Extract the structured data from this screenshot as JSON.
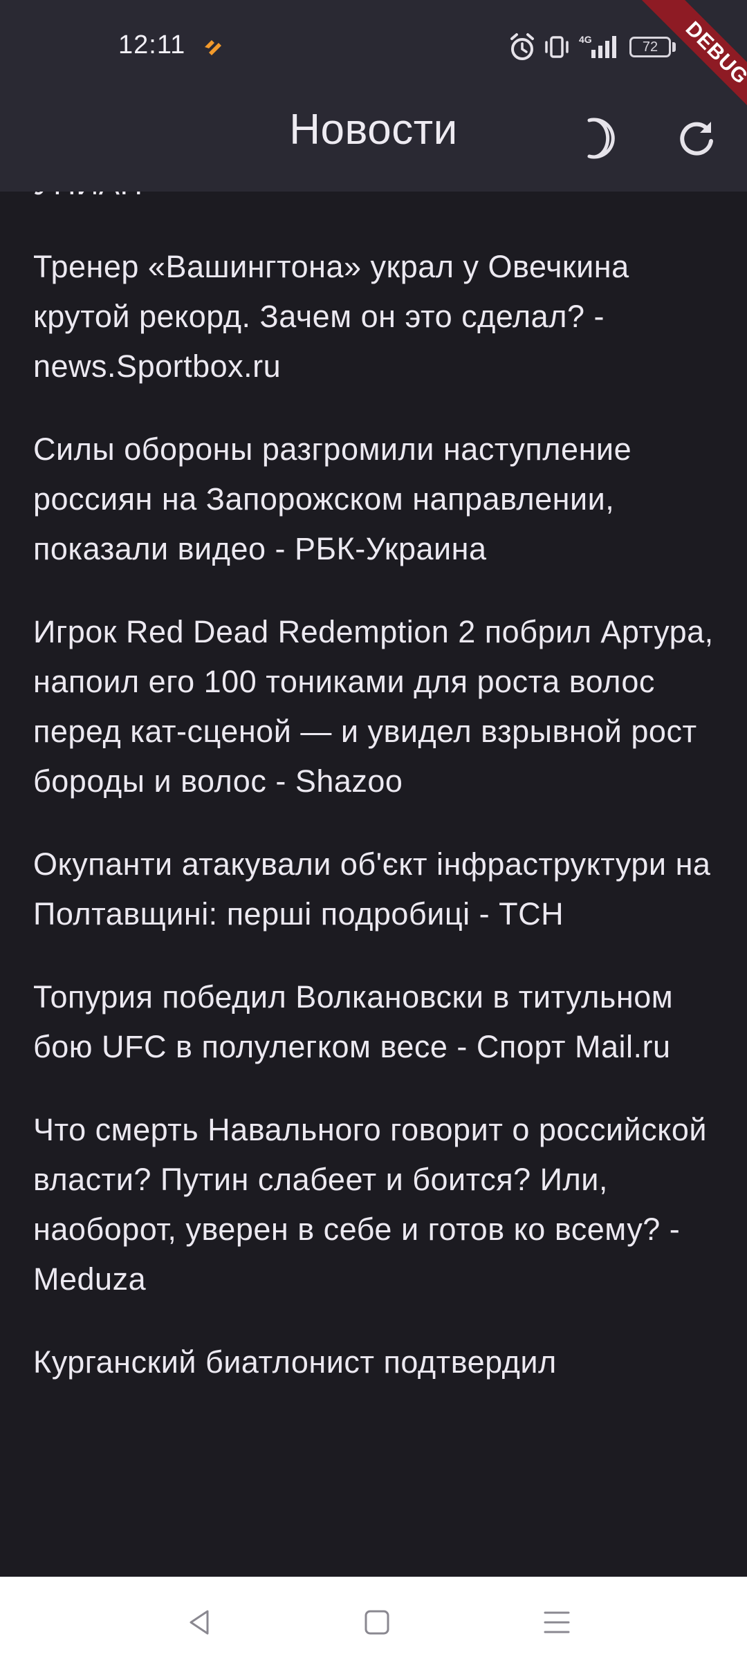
{
  "status_bar": {
    "time": "12:11",
    "network_label": "4G",
    "battery_level": "72"
  },
  "app_bar": {
    "title": "Новости",
    "icons": [
      "moon-icon",
      "refresh-icon"
    ]
  },
  "debug_banner": "DEBUG",
  "news": [
    "УНИАН",
    "Тренер «Вашингтона» украл у Овечкина крутой рекорд. Зачем он это сделал? - news.Sportbox.ru",
    "Силы обороны разгромили наступление россиян на Запорожском направлении, показали видео - РБК-Украина",
    "Игрок Red Dead Redemption 2 побрил Артура, напоил его 100 тониками для роста волос перед кат-сценой — и увидел взрывной рост бороды и волос - Shazoo",
    "Окупанти атакували об'єкт інфраструктури на Полтавщині: перші подробиці - ТСН",
    "Топурия победил Волкановски в титульном бою UFC в полулегком весе - Спорт Mail.ru",
    "Что смерть Навального говорит о российской власти? Путин слабеет и боится? Или, наоборот, уверен в себе и готов ко всему? - Meduza",
    "Курганский биатлонист подтвердил"
  ],
  "nav_bar": {
    "icons": [
      "back-icon",
      "home-icon",
      "menu-icon"
    ]
  },
  "colors": {
    "background": "#1c1b21",
    "app_bar": "#2a2933",
    "text": "#ece9f1",
    "debug_ribbon": "#8e1b24",
    "nav_bar": "#ffffff"
  }
}
